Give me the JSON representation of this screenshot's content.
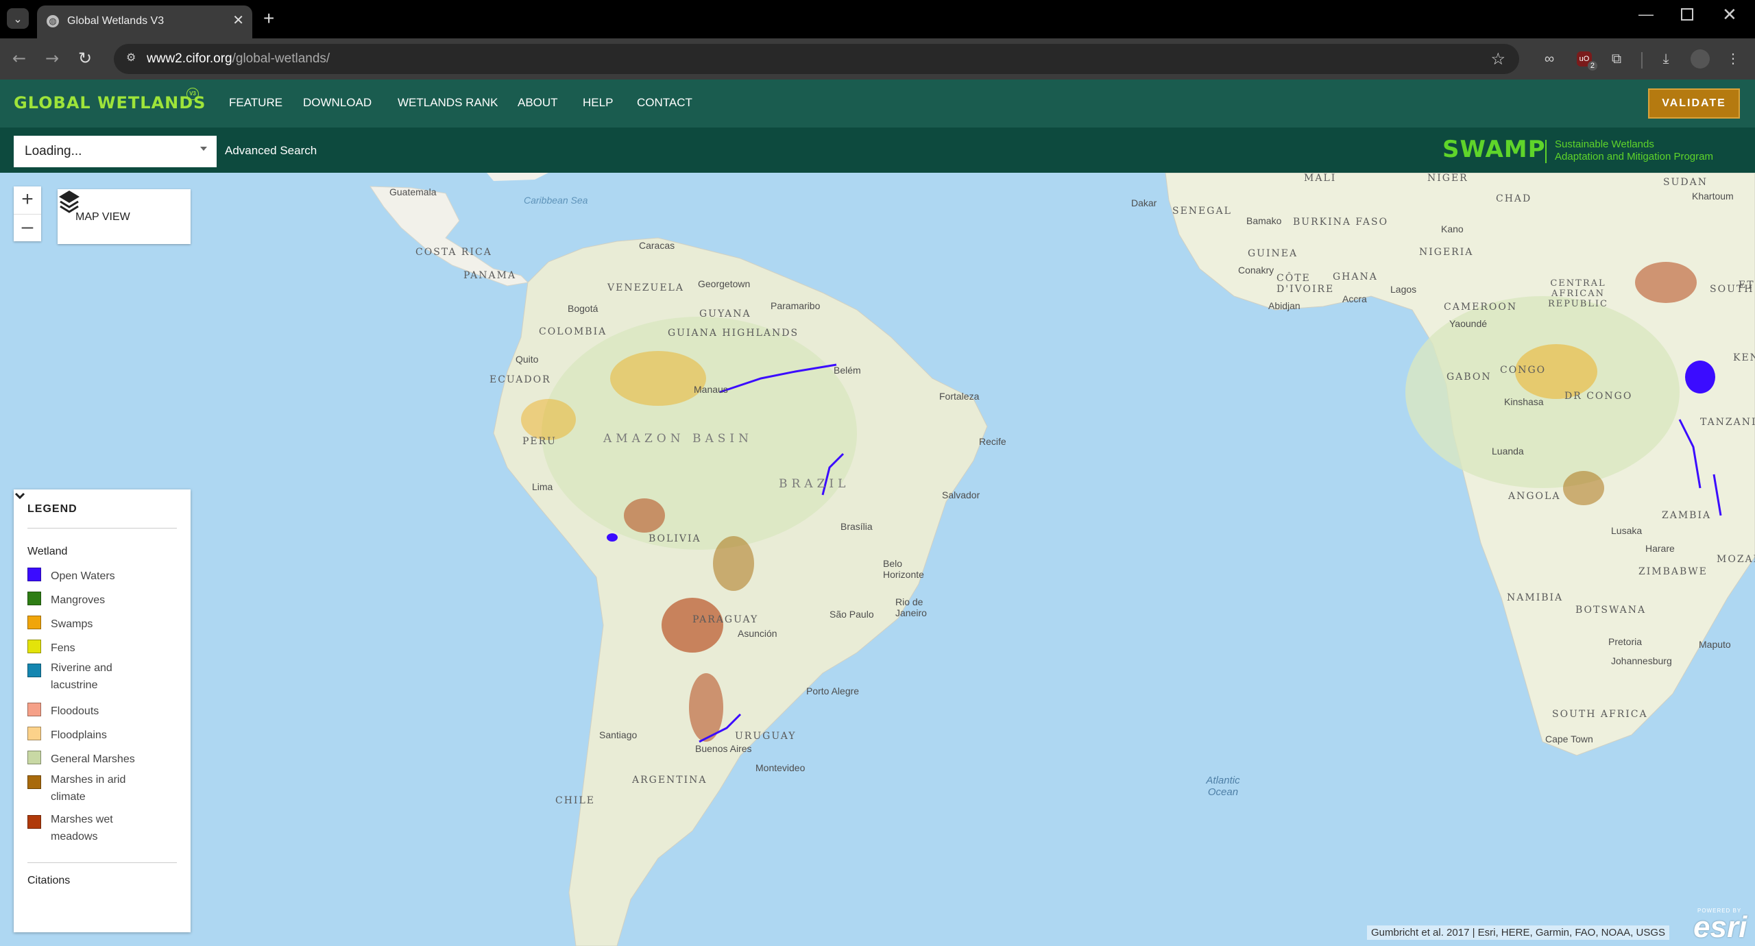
{
  "browser": {
    "tab_title": "Global Wetlands V3",
    "url_host": "www2.cifor.org",
    "url_path": "/global-wetlands/",
    "extension_badge_count": "2"
  },
  "app": {
    "logo_text": "GLOBAL WETLANDS",
    "logo_badge": "V3",
    "nav": [
      "FEATURE",
      "DOWNLOAD",
      "WETLANDS RANK",
      "ABOUT",
      "HELP",
      "CONTACT"
    ],
    "validate_label": "VALIDATE",
    "search_value": "Loading...",
    "advanced_search_label": "Advanced Search",
    "partner_logo": "SWAMP",
    "partner_tagline_1": "Sustainable Wetlands",
    "partner_tagline_2": "Adaptation and Mitigation Program"
  },
  "map": {
    "view_button_label": "MAP VIEW",
    "zoom_in": "+",
    "zoom_out": "–",
    "attribution": "Gumbricht et al. 2017 | Esri, HERE, Garmin, FAO, NOAA, USGS",
    "esri_powered": "POWERED BY",
    "esri_word": "esri",
    "labels": {
      "caribbean": "Caribbean Sea",
      "guatemala": "Guatemala",
      "costa_rica": "COSTA RICA",
      "panama": "PANAMA",
      "caracas": "Caracas",
      "venezuela": "VENEZUELA",
      "georgetown": "Georgetown",
      "guyana": "GUYANA",
      "paramaribo": "Paramaribo",
      "bogota": "Bogotá",
      "colombia": "COLOMBIA",
      "guiana_highlands": "GUIANA HIGHLANDS",
      "quito": "Quito",
      "ecuador": "ECUADOR",
      "manaus": "Manaus",
      "belem": "Belém",
      "fortaleza": "Fortaleza",
      "amazon_basin": "AMAZON BASIN",
      "peru": "PERU",
      "recife": "Recife",
      "brazil": "BRAZIL",
      "lima": "Lima",
      "salvador": "Salvador",
      "brasilia": "Brasília",
      "bolivia": "BOLIVIA",
      "belo_horizonte": "Belo Horizonte",
      "sao_paulo": "São Paulo",
      "rio": "Rio de Janeiro",
      "paraguay": "PARAGUAY",
      "asuncion": "Asunción",
      "porto_alegre": "Porto Alegre",
      "santiago": "Santiago",
      "buenos_aires": "Buenos Aires",
      "uruguay": "URUGUAY",
      "montevideo": "Montevideo",
      "argentina": "ARGENTINA",
      "chile": "CHILE",
      "atlantic": "Atlantic Ocean",
      "mali": "MALI",
      "niger": "NIGER",
      "sudan": "SUDAN",
      "khartoum": "Khartoum",
      "dakar": "Dakar",
      "senegal": "SENEGAL",
      "bamako": "Bamako",
      "burkina": "BURKINA FASO",
      "chad": "CHAD",
      "kano": "Kano",
      "nigeria": "NIGERIA",
      "guinea": "GUINEA",
      "conakry": "Conakry",
      "cote": "CÔTE D'IVOIRE",
      "ghana": "GHANA",
      "abidjan": "Abidjan",
      "accra": "Accra",
      "lagos": "Lagos",
      "car": "CENTRAL AFRICAN REPUBLIC",
      "cameroon": "CAMEROON",
      "yaounde": "Yaoundé",
      "gabon": "GABON",
      "congo": "CONGO",
      "dr_congo": "DR CONGO",
      "kinshasa": "Kinshasa",
      "tanzania": "TANZANIA",
      "luanda": "Luanda",
      "angola": "ANGOLA",
      "zambia": "ZAMBIA",
      "lusaka": "Lusaka",
      "harare": "Harare",
      "zimbabwe": "ZIMBABWE",
      "mozambique": "MOZAMBIQ",
      "namibia": "NAMIBIA",
      "botswana": "BOTSWANA",
      "pretoria": "Pretoria",
      "johannesburg": "Johannesburg",
      "maputo": "Maputo",
      "south_africa": "SOUTH AFRICA",
      "cape_town": "Cape Town",
      "south_sudan": "SOUTH",
      "kenya": "KEN",
      "ethiopia": "ET"
    }
  },
  "legend": {
    "title": "LEGEND",
    "group": "Wetland",
    "items": [
      {
        "label": "Open Waters",
        "color": "#3b0cff"
      },
      {
        "label": "Mangroves",
        "color": "#2e7d14"
      },
      {
        "label": "Swamps",
        "color": "#f0a50a"
      },
      {
        "label": "Fens",
        "color": "#e3e30a"
      },
      {
        "label": "Riverine and lacustrine",
        "color": "#1486b0"
      },
      {
        "label": "Floodouts",
        "color": "#f5a088"
      },
      {
        "label": "Floodplains",
        "color": "#fcd28a"
      },
      {
        "label": "General Marshes",
        "color": "#c8d8a4"
      },
      {
        "label": "Marshes in arid climate",
        "color": "#a86a0c"
      },
      {
        "label": "Marshes wet meadows",
        "color": "#b03a0a"
      }
    ],
    "citations_label": "Citations"
  },
  "colors": {
    "header_bg": "#1a5c4f",
    "subheader_bg": "#0d4a3e",
    "logo_green": "#9ee43a",
    "validate_bg": "#b57a10",
    "ocean": "#aed7f2",
    "land": "#f2f1ea"
  }
}
